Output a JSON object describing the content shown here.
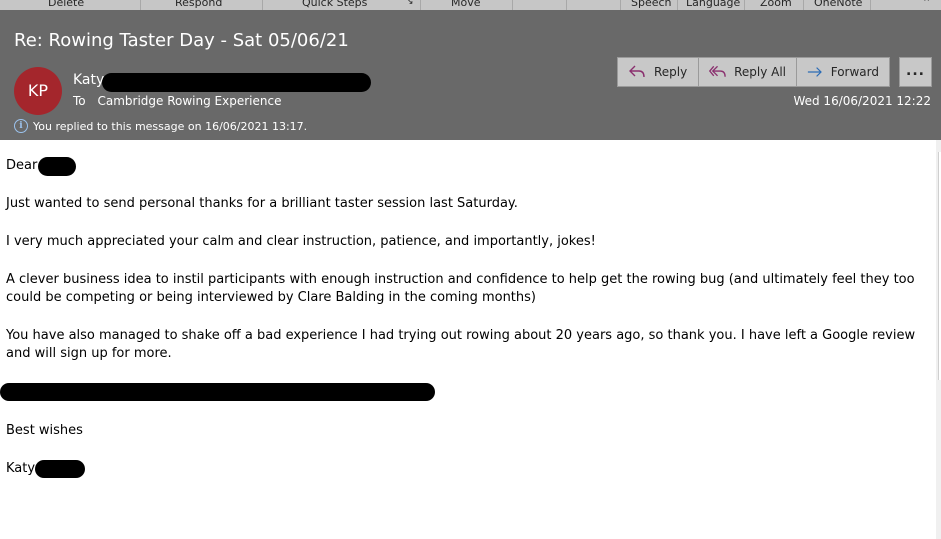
{
  "ribbon": {
    "groups": [
      "Delete",
      "Respond",
      "Quick Steps",
      "Move",
      "Speech",
      "Language",
      "Zoom",
      "OneNote"
    ]
  },
  "message": {
    "subject": "Re: Rowing Taster Day - Sat 05/06/21",
    "avatar_initials": "KP",
    "avatar_color": "#a4262c",
    "sender_name": "Katy",
    "to_label": "To",
    "to_value": "Cambridge Rowing Experience",
    "info_text": "You replied to this message on 16/06/2021 13:17.",
    "date": "Wed 16/06/2021 12:22"
  },
  "actions": {
    "reply": "Reply",
    "reply_all": "Reply All",
    "forward": "Forward",
    "more": "..."
  },
  "body": {
    "greeting": "Dear",
    "para1": "Just wanted to send personal thanks for a brilliant taster session last Saturday.",
    "para2": "I very much appreciated your calm and clear instruction, patience, and importantly, jokes!",
    "para3": "A clever business idea to instil participants with enough instruction and confidence to help get the rowing bug (and ultimately feel they too could be competing or being interviewed by Clare Balding in the coming months)",
    "para4": "You have also managed to shake off a bad experience I had trying out rowing about 20 years ago, so thank you. I have left a Google review and will sign up for more.",
    "closing": "Best wishes",
    "signature": "Katy"
  }
}
